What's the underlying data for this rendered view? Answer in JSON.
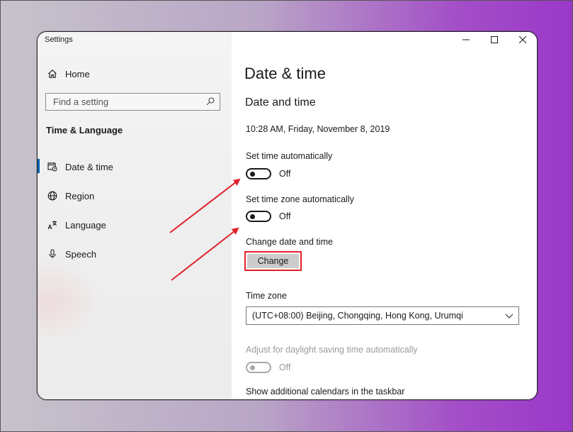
{
  "window": {
    "title": "Settings"
  },
  "sidebar": {
    "home_label": "Home",
    "search": {
      "placeholder": "Find a setting"
    },
    "section_heading": "Time & Language",
    "items": [
      {
        "label": "Date & time",
        "icon": "date-time-icon",
        "selected": true
      },
      {
        "label": "Region",
        "icon": "globe-icon",
        "selected": false
      },
      {
        "label": "Language",
        "icon": "language-icon",
        "selected": false
      },
      {
        "label": "Speech",
        "icon": "microphone-icon",
        "selected": false
      }
    ]
  },
  "main": {
    "page_title": "Date & time",
    "section_title": "Date and time",
    "current_datetime": "10:28 AM, Friday, November 8, 2019",
    "set_time_auto": {
      "label": "Set time automatically",
      "state": "Off"
    },
    "set_timezone_auto": {
      "label": "Set time zone automatically",
      "state": "Off"
    },
    "change_date_time": {
      "label": "Change date and time",
      "button_label": "Change"
    },
    "time_zone": {
      "label": "Time zone",
      "selected": "(UTC+08:00) Beijing, Chongqing, Hong Kong, Urumqi"
    },
    "daylight_saving": {
      "label": "Adjust for daylight saving time automatically",
      "state": "Off",
      "disabled": true
    },
    "additional_calendars_label": "Show additional calendars in the taskbar"
  },
  "colors": {
    "accent": "#0063b1",
    "annotation_red": "#e0202a",
    "button_bg": "#cccccc"
  }
}
